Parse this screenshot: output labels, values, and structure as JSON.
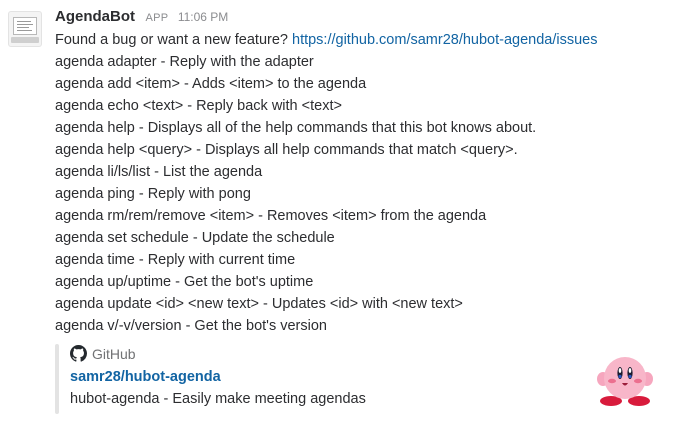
{
  "message": {
    "sender": "AgendaBot",
    "badge": "APP",
    "timestamp": "11:06 PM",
    "intro": "Found a bug or want a new feature? ",
    "intro_link": "https://github.com/samr28/hubot-agenda/issues",
    "lines": [
      "agenda adapter - Reply with the adapter",
      "agenda add <item> - Adds <item> to the agenda",
      "agenda echo <text> - Reply back with <text>",
      "agenda help - Displays all of the help commands that this bot knows about.",
      "agenda help <query> - Displays all help commands that match <query>.",
      "agenda li/ls/list - List the agenda",
      "agenda ping - Reply with pong",
      "agenda rm/rem/remove <item> - Removes <item> from the agenda",
      "agenda set schedule - Update the schedule",
      "agenda time - Reply with current time",
      "agenda up/uptime - Get the bot's uptime",
      "agenda update <id> <new text> - Updates <id> with <new text>",
      "agenda v/-v/version - Get the bot's version"
    ]
  },
  "attachment": {
    "service": "GitHub",
    "service_icon": "github-icon",
    "title": "samr28/hubot-agenda",
    "text": "hubot-agenda - Easily make meeting agendas",
    "thumbnail_icon": "kirby-thumbnail"
  },
  "colors": {
    "link": "#1264a3",
    "text": "#2c2d30",
    "muted": "#8b8c8f",
    "bar": "#e3e3e3"
  }
}
